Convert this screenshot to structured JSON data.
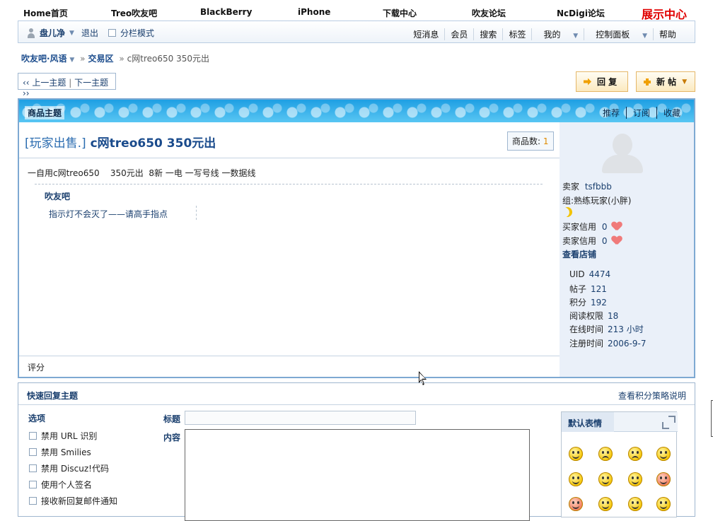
{
  "topnav": {
    "links": [
      "Home首页",
      "Treo吹友吧",
      "BlackBerry",
      "iPhone",
      "下载中心",
      "吹友论坛",
      "NcDigi论坛"
    ],
    "showcase": "展示中心"
  },
  "userbar": {
    "username": "盘儿净",
    "logout": "退出",
    "split_mode": "分栏模式",
    "menu": [
      "短消息",
      "会员",
      "搜索",
      "标签",
      "我的",
      "控制面板",
      "帮助"
    ]
  },
  "breadcrumb": {
    "forum": "吹友吧·风语",
    "section": "交易区",
    "current": "c网treo650 350元出"
  },
  "thread_nav": {
    "prev": "上一主题",
    "next": "下一主题"
  },
  "buttons": {
    "reply": "回  复",
    "new_post": "新  帖"
  },
  "main": {
    "header_title": "商品主题",
    "actions": [
      "推荐",
      "订阅",
      "收藏"
    ],
    "post_tag": "[玩家出售.]",
    "post_title": "c网treo650 350元出",
    "goods_count_label": "商品数:",
    "goods_count": "1",
    "body": "一自用c网treo650    350元出  8新 一电 一写号线 一数据线",
    "quote_author": "吹友吧",
    "quote_text": "指示灯不会灭了——请高手指点",
    "rating_label": "评分"
  },
  "seller": {
    "seller_label": "卖家",
    "seller_name": "tsfbbb",
    "group": "组:熟练玩家(小胖)",
    "buyer_credit_label": "买家信用",
    "buyer_credit": "0",
    "seller_credit_label": "卖家信用",
    "seller_credit": "0",
    "view_shop": "查看店铺",
    "stats": [
      {
        "label": "UID",
        "value": "4474"
      },
      {
        "label": "帖子",
        "value": "121"
      },
      {
        "label": "积分",
        "value": "192"
      },
      {
        "label": "阅读权限",
        "value": "18"
      },
      {
        "label": "在线时间",
        "value": "213 小时"
      },
      {
        "label": "注册时间",
        "value": "2006-9-7"
      }
    ]
  },
  "quick_reply": {
    "title": "快速回复主题",
    "policy_link": "查看积分策略说明",
    "options_title": "选项",
    "options": [
      "禁用 URL 识别",
      "禁用 Smilies",
      "禁用 Discuz!代码",
      "使用个人签名",
      "接收新回复邮件通知"
    ],
    "subject_label": "标题",
    "content_label": "内容",
    "smilies_tab": "默认表情"
  }
}
